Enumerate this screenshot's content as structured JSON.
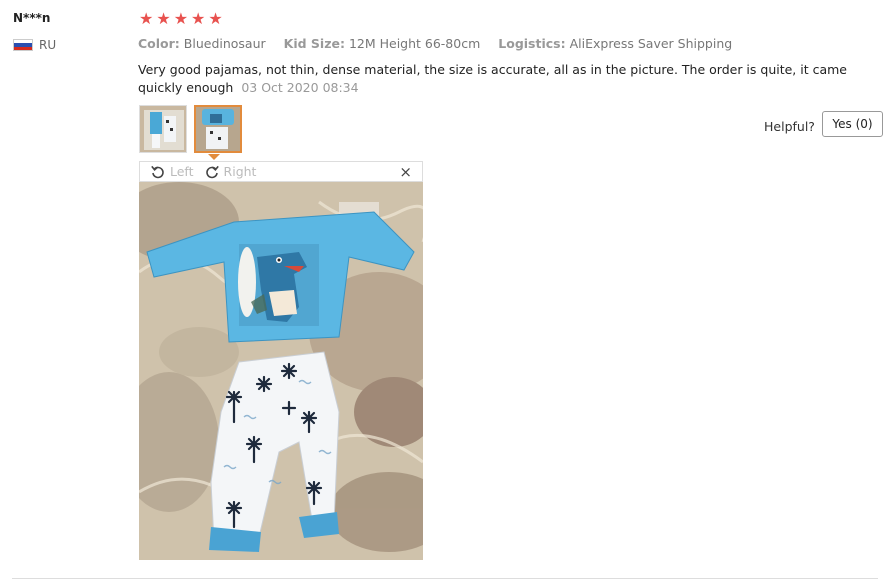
{
  "user": {
    "name": "N***n",
    "country": "RU"
  },
  "rating": {
    "stars": 5,
    "max": 5,
    "color": "#e8524f"
  },
  "meta": {
    "color_label": "Color:",
    "color_value": "Bluedinosaur",
    "size_label": "Kid Size:",
    "size_value": "12M Height 66-80cm",
    "logistics_label": "Logistics:",
    "logistics_value": "AliExpress Saver Shipping"
  },
  "review": {
    "text": "Very good pajamas, not thin, dense material, the size is accurate, all as in the picture. The order is quite, it came quickly enough",
    "date": "03 Oct 2020 08:34"
  },
  "helpful": {
    "label": "Helpful?",
    "button": "Yes (0)"
  },
  "viewer": {
    "left_label": "Left",
    "right_label": "Right",
    "close": "×"
  },
  "icons": {
    "rotate_left": "rotate-left-icon",
    "rotate_right": "rotate-right-icon",
    "close": "close-icon",
    "star": "star-icon",
    "flag": "russia-flag-icon"
  },
  "colors": {
    "accent": "#e28b3c",
    "star": "#e8524f"
  }
}
